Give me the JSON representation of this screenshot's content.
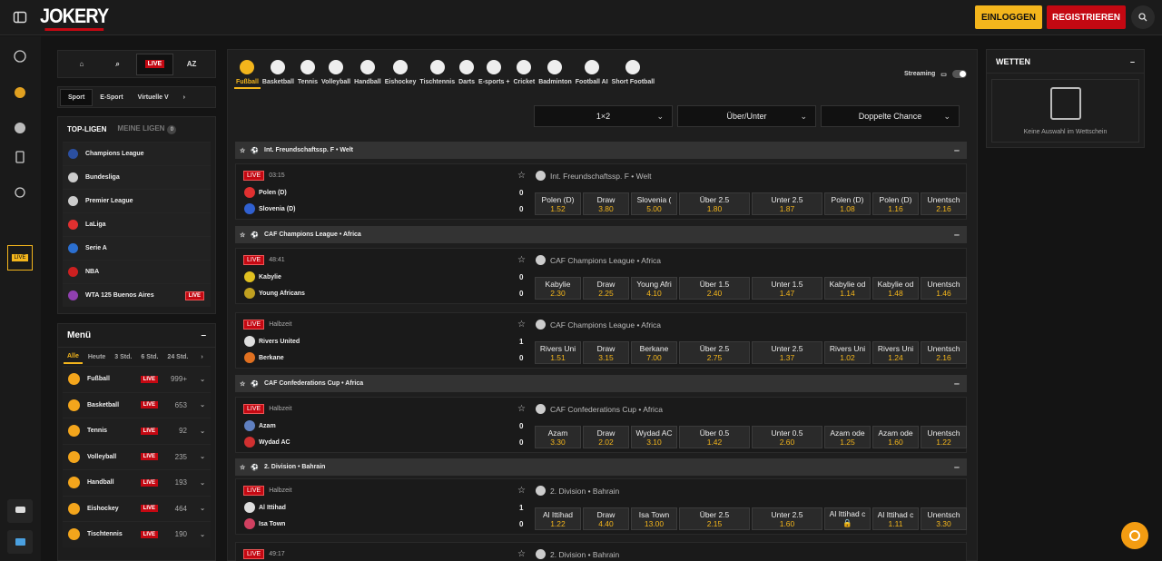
{
  "header": {
    "logo": "JOKERY",
    "login": "EINLOGGEN",
    "register": "REGISTRIEREN"
  },
  "quicknav": {
    "live": "LIVE",
    "az": "AZ"
  },
  "sport_tabs": [
    "Sport",
    "E-Sport",
    "Virtuelle V"
  ],
  "leagues": {
    "tab_top": "TOP-LIGEN",
    "tab_mine": "MEINE LIGEN",
    "mine_count": "0",
    "items": [
      {
        "name": "Champions League",
        "color": "#2b4fa0"
      },
      {
        "name": "Bundesliga",
        "color": "#cccccc"
      },
      {
        "name": "Premier League",
        "color": "#cccccc"
      },
      {
        "name": "LaLiga",
        "color": "#e03030"
      },
      {
        "name": "Serie A",
        "color": "#2b6fd0"
      },
      {
        "name": "NBA",
        "color": "#cc2020"
      },
      {
        "name": "WTA 125 Buenos Aires",
        "color": "#9040b0",
        "live": "LIVE"
      }
    ]
  },
  "menu": {
    "title": "Menü",
    "tabs": [
      "Alle",
      "Heute",
      "3 Std.",
      "6 Std.",
      "24 Std."
    ],
    "items": [
      {
        "name": "Fußball",
        "live": "LIVE",
        "count": "999+"
      },
      {
        "name": "Basketball",
        "live": "LIVE",
        "count": "653"
      },
      {
        "name": "Tennis",
        "live": "LIVE",
        "count": "92"
      },
      {
        "name": "Volleyball",
        "live": "LIVE",
        "count": "235"
      },
      {
        "name": "Handball",
        "live": "LIVE",
        "count": "193"
      },
      {
        "name": "Eishockey",
        "live": "LIVE",
        "count": "464"
      },
      {
        "name": "Tischtennis",
        "live": "LIVE",
        "count": "190"
      }
    ]
  },
  "sports": [
    "Fußball",
    "Basketball",
    "Tennis",
    "Volleyball",
    "Handball",
    "Eishockey",
    "Tischtennis",
    "Darts",
    "E-sports +",
    "Cricket",
    "Badminton",
    "Football AI",
    "Short Football"
  ],
  "streaming": "Streaming",
  "markets": [
    "1×2",
    "Über/Unter",
    "Doppelte Chance"
  ],
  "sections": [
    {
      "title": "Int. Freundschaftssp. F • Welt"
    },
    {
      "title": "CAF Champions League • Africa"
    },
    {
      "title": "CAF Confederations Cup • Africa"
    },
    {
      "title": "2. Division • Bahrain"
    }
  ],
  "events": [
    {
      "status": "03:15",
      "league": "Int. Freundschaftssp. F • Welt",
      "home": "Polen (D)",
      "away": "Slovenia (D)",
      "hs": "0",
      "as": "0",
      "hc": "#e03030",
      "ac": "#3060d0",
      "odds": [
        [
          "Polen (D)",
          "1.52"
        ],
        [
          "Draw",
          "3.80"
        ],
        [
          "Slovenia (",
          "5.00"
        ],
        [
          "Über 2.5",
          "1.80"
        ],
        [
          "Unter 2.5",
          "1.87"
        ],
        [
          "Polen (D)",
          "1.08"
        ],
        [
          "Polen (D)",
          "1.16"
        ],
        [
          "Unentsch",
          "2.16"
        ]
      ]
    },
    {
      "status": "48:41",
      "league": "CAF Champions League • Africa",
      "home": "Kabylie",
      "away": "Young Africans",
      "hs": "0",
      "as": "0",
      "hc": "#e0c020",
      "ac": "#c0a020",
      "odds": [
        [
          "Kabylie",
          "2.30"
        ],
        [
          "Draw",
          "2.25"
        ],
        [
          "Young Afri",
          "4.10"
        ],
        [
          "Über 1.5",
          "2.40"
        ],
        [
          "Unter 1.5",
          "1.47"
        ],
        [
          "Kabylie od",
          "1.14"
        ],
        [
          "Kabylie od",
          "1.48"
        ],
        [
          "Unentsch",
          "1.46"
        ]
      ]
    },
    {
      "status": "Halbzeit",
      "league": "CAF Champions League • Africa",
      "home": "Rivers United",
      "away": "Berkane",
      "hs": "1",
      "as": "0",
      "hc": "#dddddd",
      "ac": "#e07020",
      "odds": [
        [
          "Rivers Uni",
          "1.51"
        ],
        [
          "Draw",
          "3.15"
        ],
        [
          "Berkane",
          "7.00"
        ],
        [
          "Über 2.5",
          "2.75"
        ],
        [
          "Unter 2.5",
          "1.37"
        ],
        [
          "Rivers Uni",
          "1.02"
        ],
        [
          "Rivers Uni",
          "1.24"
        ],
        [
          "Unentsch",
          "2.16"
        ]
      ]
    },
    {
      "status": "Halbzeit",
      "league": "CAF Confederations Cup • Africa",
      "home": "Azam",
      "away": "Wydad AC",
      "hs": "0",
      "as": "0",
      "hc": "#6080c0",
      "ac": "#d03030",
      "odds": [
        [
          "Azam",
          "3.30"
        ],
        [
          "Draw",
          "2.02"
        ],
        [
          "Wydad AC",
          "3.10"
        ],
        [
          "Über 0.5",
          "1.42"
        ],
        [
          "Unter 0.5",
          "2.60"
        ],
        [
          "Azam ode",
          "1.25"
        ],
        [
          "Azam ode",
          "1.60"
        ],
        [
          "Unentsch",
          "1.22"
        ]
      ]
    },
    {
      "status": "Halbzeit",
      "league": "2. Division • Bahrain",
      "home": "Al Ittihad",
      "away": "Isa Town",
      "hs": "1",
      "as": "0",
      "hc": "#dddddd",
      "ac": "#d04060",
      "odds": [
        [
          "Al Ittihad",
          "1.22"
        ],
        [
          "Draw",
          "4.40"
        ],
        [
          "Isa Town",
          "13.00"
        ],
        [
          "Über 2.5",
          "2.15"
        ],
        [
          "Unter 2.5",
          "1.60"
        ],
        [
          "Al Ittihad c",
          "🔒"
        ],
        [
          "Al Ittihad c",
          "1.11"
        ],
        [
          "Unentsch",
          "3.30"
        ]
      ]
    },
    {
      "status": "49:17",
      "league": "2. Division • Bahrain"
    }
  ],
  "betslip": {
    "title": "WETTEN",
    "empty": "Keine Auswahl im Wettschein"
  }
}
